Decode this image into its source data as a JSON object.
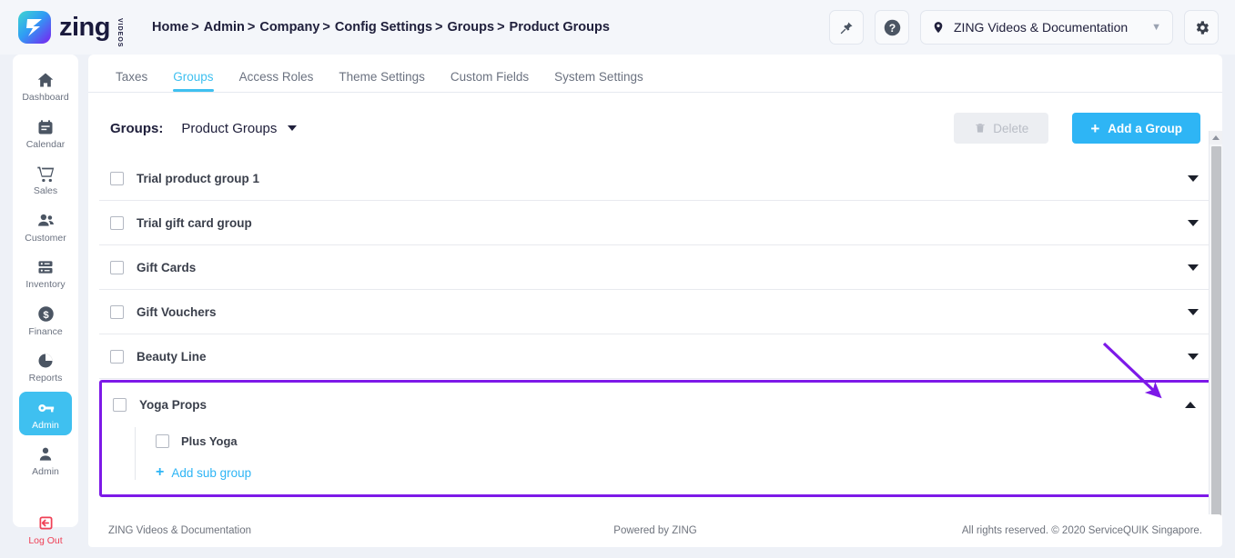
{
  "brand": {
    "name": "zing",
    "sub": "VIDEOS"
  },
  "breadcrumb": {
    "items": [
      "Home",
      "Admin",
      "Company",
      "Config Settings",
      "Groups",
      "Product Groups"
    ],
    "separator": ">"
  },
  "topbar": {
    "pin_icon": "pin-icon",
    "help_icon": "help-circle-icon",
    "location": {
      "icon": "location-pin-icon",
      "value": "ZING Videos & Documentation",
      "caret": "chevron-down-icon"
    },
    "settings_icon": "gear-icon"
  },
  "sidebar": {
    "items": [
      {
        "label": "Dashboard",
        "icon": "home-icon",
        "active": false
      },
      {
        "label": "Calendar",
        "icon": "calendar-icon",
        "active": false
      },
      {
        "label": "Sales",
        "icon": "shopping-cart-icon",
        "active": false
      },
      {
        "label": "Customer",
        "icon": "users-icon",
        "active": false
      },
      {
        "label": "Inventory",
        "icon": "server-icon",
        "active": false
      },
      {
        "label": "Finance",
        "icon": "dollar-circle-icon",
        "active": false
      },
      {
        "label": "Reports",
        "icon": "pie-chart-icon",
        "active": false
      },
      {
        "label": "Admin",
        "icon": "key-icon",
        "active": true
      },
      {
        "label": "Admin",
        "icon": "user-icon",
        "active": false
      }
    ],
    "logout": {
      "label": "Log Out",
      "icon": "logout-icon"
    }
  },
  "tabs": [
    {
      "label": "Taxes",
      "active": false
    },
    {
      "label": "Groups",
      "active": true
    },
    {
      "label": "Access Roles",
      "active": false
    },
    {
      "label": "Theme Settings",
      "active": false
    },
    {
      "label": "Custom Fields",
      "active": false
    },
    {
      "label": "System Settings",
      "active": false
    }
  ],
  "panel": {
    "groups_label": "Groups:",
    "groups_selected": "Product Groups",
    "delete_button": "Delete",
    "add_group_button": "Add a Group",
    "delete_icon": "trash-icon",
    "add_icon": "plus-icon"
  },
  "groups": [
    {
      "name": "Trial product group 1",
      "expanded": false,
      "checked": false,
      "highlighted": false
    },
    {
      "name": "Trial gift card group",
      "expanded": false,
      "checked": false,
      "highlighted": false
    },
    {
      "name": "Gift Cards",
      "expanded": false,
      "checked": false,
      "highlighted": false
    },
    {
      "name": "Gift Vouchers",
      "expanded": false,
      "checked": false,
      "highlighted": false
    },
    {
      "name": "Beauty Line",
      "expanded": false,
      "checked": false,
      "highlighted": false
    },
    {
      "name": "Yoga Props",
      "expanded": true,
      "checked": false,
      "highlighted": true
    }
  ],
  "subgroup": {
    "name": "Plus Yoga",
    "add_label": "Add sub group"
  },
  "footer": {
    "left": "ZING Videos & Documentation",
    "center": "Powered by ZING",
    "right": "All rights reserved. © 2020 ServiceQUIK Singapore."
  },
  "colors": {
    "accent_blue": "#2eb5f5",
    "active_nav": "#3fc0f0",
    "highlight_purple": "#7d19e8",
    "logout_red": "#ef4056",
    "page_bg": "#eef1f7"
  },
  "annotation": {
    "type": "arrow",
    "color": "#7d19e8",
    "points_to": "collapse-chevron-yoga-props"
  }
}
